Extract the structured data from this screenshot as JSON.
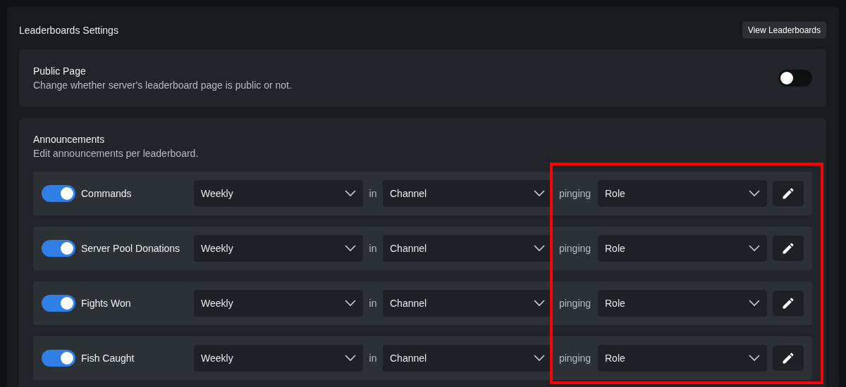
{
  "title": "Leaderboards Settings",
  "view_button": "View Leaderboards",
  "public_page": {
    "title": "Public Page",
    "description": "Change whether server's leaderboard page is public or not.",
    "on": false
  },
  "announcements": {
    "title": "Announcements",
    "description": "Edit announcements per leaderboard.",
    "rows": [
      {
        "on": true,
        "name": "Commands",
        "frequency": "Weekly",
        "connector": "in",
        "channel": "Channel",
        "ping_label": "pinging",
        "role": "Role"
      },
      {
        "on": true,
        "name": "Server Pool Donations",
        "frequency": "Weekly",
        "connector": "in",
        "channel": "Channel",
        "ping_label": "pinging",
        "role": "Role"
      },
      {
        "on": true,
        "name": "Fights Won",
        "frequency": "Weekly",
        "connector": "in",
        "channel": "Channel",
        "ping_label": "pinging",
        "role": "Role"
      },
      {
        "on": true,
        "name": "Fish Caught",
        "frequency": "Weekly",
        "connector": "in",
        "channel": "Channel",
        "ping_label": "pinging",
        "role": "Role"
      }
    ]
  }
}
